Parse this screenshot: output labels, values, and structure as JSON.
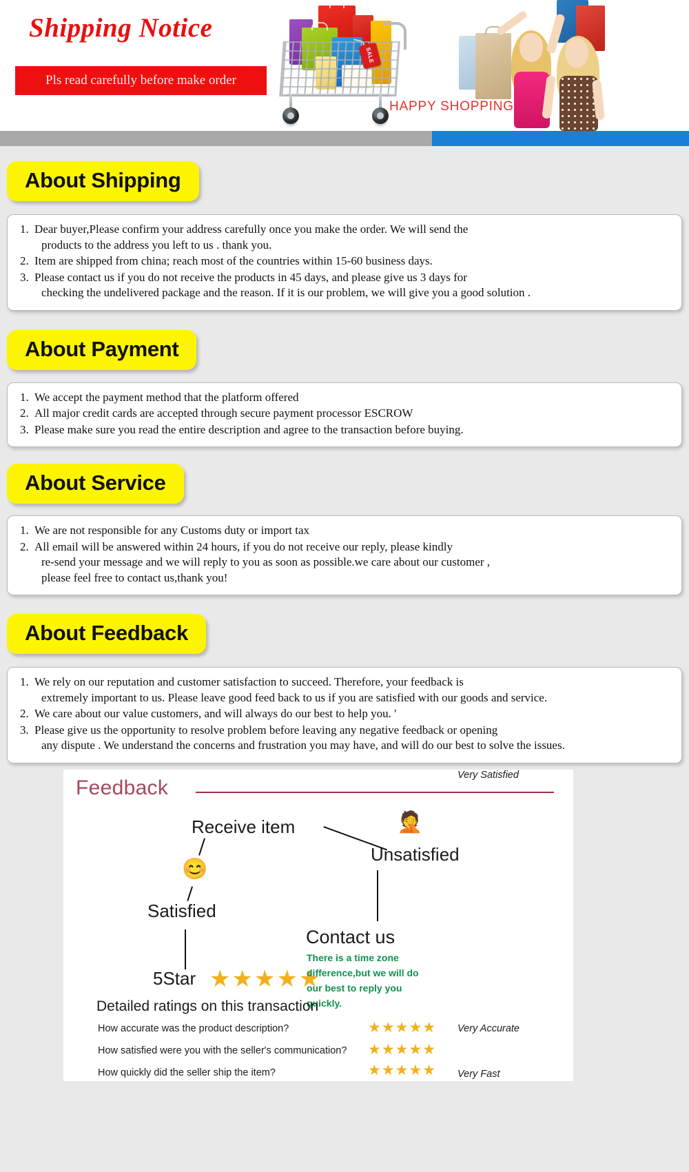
{
  "header": {
    "title": "Shipping Notice",
    "subtitle": "Pls read carefully before make order",
    "happy_shopping": "HAPPY SHOPPING",
    "sale_tag": "SALE",
    "title_color": "#e8100f",
    "subtitle_bg": "#ee1010",
    "divider_gray": "#a9a9a9",
    "divider_blue": "#1a7fd6"
  },
  "sections": [
    {
      "badge": "About Shipping",
      "items": [
        {
          "num": "1.",
          "line1": "Dear buyer,Please confirm your address carefully once you make the order. We will send the",
          "line2": "products to the address you left to us . thank you."
        },
        {
          "num": "2.",
          "line1": "Item are shipped from china; reach most of the countries within 15-60 business days.",
          "line2": ""
        },
        {
          "num": "3.",
          "line1": "Please contact us if you do not receive the products in 45 days, and please give us 3 days for",
          "line2": "checking the undelivered package and the reason. If it is our problem, we will give you a good solution ."
        }
      ]
    },
    {
      "badge": "About Payment",
      "items": [
        {
          "num": "1.",
          "line1": "We accept the payment method that the platform offered",
          "line2": ""
        },
        {
          "num": "2.",
          "line1": "All major credit cards are accepted through secure payment processor ESCROW",
          "line2": ""
        },
        {
          "num": "3.",
          "line1": "Please make sure you read the entire description and agree to the transaction before buying.",
          "line2": ""
        }
      ]
    },
    {
      "badge": "About Service",
      "items": [
        {
          "num": "1.",
          "line1": "We are not responsible for any Customs duty or import tax",
          "line2": ""
        },
        {
          "num": "2.",
          "line1": "All email will be answered within 24 hours, if you do not receive our reply, please kindly",
          "line2": "re-send your message and we will reply to you as soon as possible.we care about our customer ,",
          "line3": "please feel free to contact us,thank you!"
        }
      ]
    },
    {
      "badge": "About Feedback",
      "items": [
        {
          "num": "1.",
          "line1": "We rely on our reputation and customer satisfaction to succeed. Therefore, your feedback is",
          "line2": "extremely important to us. Please leave good feed back to us if you are satisfied with our goods and service."
        },
        {
          "num": "2.",
          "line1": "We care about our value customers, and will always do our best to help you. '",
          "line2": ""
        },
        {
          "num": "3.",
          "line1": "Please give us the opportunity to resolve problem before leaving any negative feedback or opening",
          "line2": "any dispute . We understand the concerns and frustration you may have, and will do our best to solve the issues."
        }
      ]
    }
  ],
  "feedback_diagram": {
    "title": "Feedback",
    "title_color": "#a8475a",
    "rule_color": "#9d3344",
    "receive_item": "Receive item",
    "satisfied": "Satisfied",
    "unsatisfied": "Unsatisfied",
    "satisfied_emoji": "smiling-face-emoji",
    "unsatisfied_emoji": "unsatisfied-face-emoji",
    "five_star_label": "5Star",
    "five_star_rating": "★★★★★",
    "star_color": "#f2b01e",
    "detailed_ratings_title": "Detailed ratings on this transaction",
    "detailed_ratings": [
      {
        "question": "How accurate was the product description?",
        "stars": "★★★★★",
        "value": "Very Accurate"
      },
      {
        "question": "How satisfied were you with the seller's communication?",
        "stars": "★★★★★",
        "value": "Very Satisfied"
      },
      {
        "question": "How quickly did the seller ship the item?",
        "stars": "★★★★★",
        "value": "Very Fast"
      }
    ],
    "contact_title": "Contact us",
    "contact_note": "There is a time zone difference,but we will do our best to reply you quickly.",
    "contact_note_color": "#12904f"
  }
}
